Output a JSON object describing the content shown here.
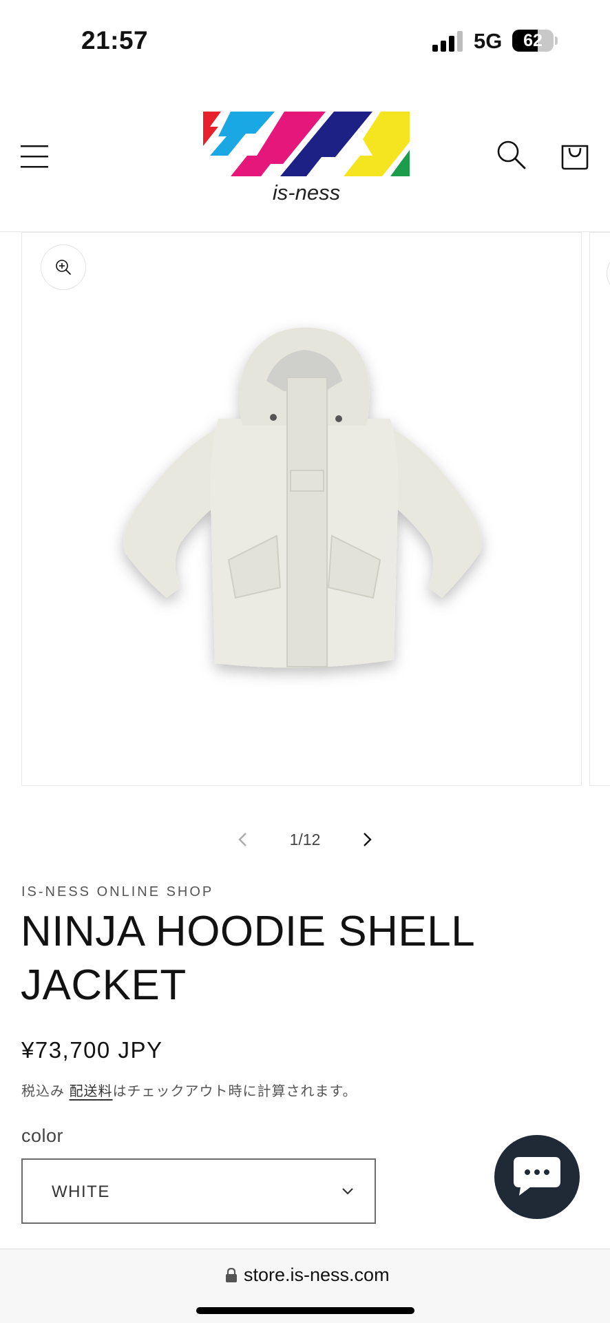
{
  "status_bar": {
    "time": "21:57",
    "network": "5G",
    "battery_level": "62",
    "battery_fraction": 0.62
  },
  "header": {
    "brand_text": "is-ness",
    "menu_icon": "hamburger-menu-icon",
    "search_icon": "search-icon",
    "cart_icon": "shopping-bag-icon",
    "logo_colors": [
      "#e6212b",
      "#19a8e3",
      "#e5177b",
      "#1d2085",
      "#f5e521",
      "#1b9d4b"
    ]
  },
  "gallery": {
    "zoom_icon": "zoom-in-icon",
    "counter": "1/12",
    "current": 1,
    "total": 12,
    "prev_icon": "chevron-left-icon",
    "next_icon": "chevron-right-icon"
  },
  "product": {
    "vendor": "IS-NESS ONLINE SHOP",
    "title": "NINJA HOODIE SHELL JACKET",
    "price": "¥73,700 JPY",
    "tax_prefix": "税込み",
    "shipping_link": "配送料",
    "tax_suffix": "はチェックアウト時に計算されます。",
    "color_label": "color",
    "color_value": "WHITE"
  },
  "chat": {
    "icon": "chat-bubble-icon",
    "color": "#1f2a36"
  },
  "browser": {
    "url": "store.is-ness.com",
    "lock_icon": "lock-icon"
  }
}
